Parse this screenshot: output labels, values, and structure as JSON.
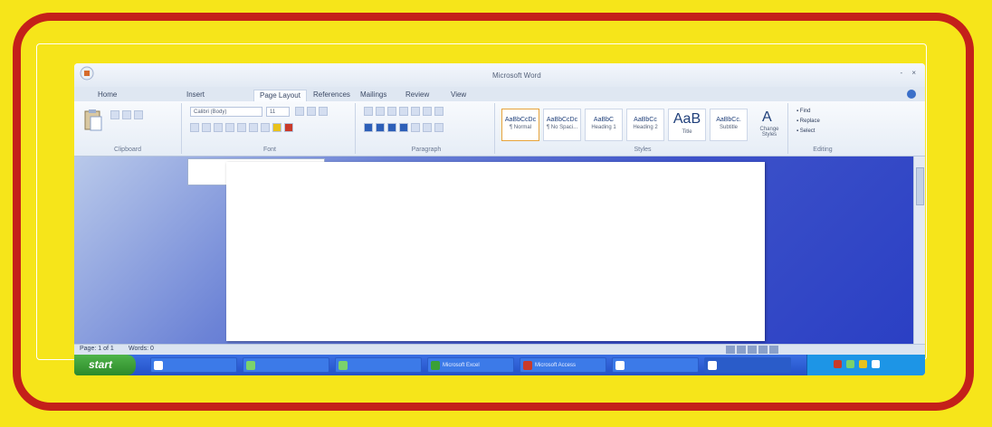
{
  "window": {
    "doc_title": "Microsoft Word",
    "office_button_label": "",
    "window_buttons": "- ×"
  },
  "ribbon": {
    "tabs": [
      {
        "label": "Home",
        "active": true
      },
      {
        "label": "Insert",
        "active": false
      },
      {
        "label": "Page Layout",
        "active": false
      },
      {
        "label": "References",
        "active": false
      },
      {
        "label": "Mailings",
        "active": false
      },
      {
        "label": "Review",
        "active": false
      },
      {
        "label": "View",
        "active": false
      }
    ],
    "font_name": "Calibri (Body)",
    "font_size": "11",
    "group_labels": {
      "clipboard": "Clipboard",
      "font": "Font",
      "paragraph": "Paragraph",
      "styles": "Styles",
      "editing": "Editing"
    },
    "styles": [
      {
        "sample": "AaBbCcDc",
        "name": "¶ Normal",
        "selected": true
      },
      {
        "sample": "AaBbCcDc",
        "name": "¶ No Spaci...",
        "selected": false
      },
      {
        "sample": "AaBbC",
        "name": "Heading 1",
        "selected": false
      },
      {
        "sample": "AaBbCc",
        "name": "Heading 2",
        "selected": false
      },
      {
        "sample": "AaB",
        "name": "Title",
        "selected": false,
        "big": true
      },
      {
        "sample": "AaBbCc.",
        "name": "Subtitle",
        "selected": false
      }
    ],
    "change_styles": "Change Styles",
    "editing": {
      "find": "Find",
      "replace": "Replace",
      "select": "Select"
    }
  },
  "nav_popup": {
    "line1": "",
    "line2": ""
  },
  "statusbar": {
    "page": "Page: 1 of 1",
    "words": "Words: 0",
    "zoom": ""
  },
  "taskbar": {
    "start_label": "start",
    "tasks": [
      {
        "label": ""
      },
      {
        "label": ""
      },
      {
        "label": ""
      },
      {
        "label": "Microsoft Excel"
      },
      {
        "label": "Microsoft Access"
      },
      {
        "label": ""
      },
      {
        "label": ""
      }
    ],
    "clock": ""
  },
  "colors": {
    "border_red": "#c4201a",
    "background_yellow": "#f6e51a",
    "desktop_blue": "#3d52c9",
    "taskbar_blue": "#2451c7",
    "start_green": "#3aa036"
  }
}
